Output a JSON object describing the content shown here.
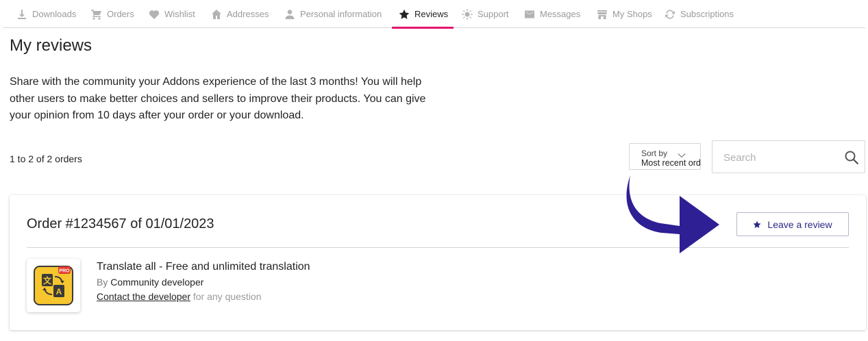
{
  "nav": {
    "items": [
      {
        "label": "Downloads",
        "icon": "download-icon",
        "active": false
      },
      {
        "label": "Orders",
        "icon": "cart-icon",
        "active": false
      },
      {
        "label": "Wishlist",
        "icon": "heart-icon",
        "active": false
      },
      {
        "label": "Addresses",
        "icon": "home-icon",
        "active": false
      },
      {
        "label": "Personal information",
        "icon": "person-icon",
        "active": false
      },
      {
        "label": "Reviews",
        "icon": "star-icon",
        "active": true
      },
      {
        "label": "Support",
        "icon": "sun-icon",
        "active": false
      },
      {
        "label": "Messages",
        "icon": "envelope-icon",
        "active": false
      },
      {
        "label": "My Shops",
        "icon": "shop-icon",
        "active": false
      },
      {
        "label": "Subscriptions",
        "icon": "refresh-icon",
        "active": false
      }
    ]
  },
  "page": {
    "title": "My reviews",
    "intro": "Share with the community your Addons experience of the last 3 months! You will help other users to make better choices and sellers to improve their products. You can give your opinion from 10 days after your order or your download.",
    "count": "1 to 2 of 2 orders"
  },
  "sort": {
    "label": "Sort by",
    "value": "Most recent orders"
  },
  "search": {
    "placeholder": "Search"
  },
  "order": {
    "title": "Order #1234567 of 01/01/2023",
    "review_button": "Leave a review",
    "product": {
      "name": "Translate all - Free and unlimited translation",
      "by_prefix": "By",
      "author": "Community developer",
      "contact_link": "Contact the developer",
      "contact_suffix": "for any question",
      "badge": "PRO"
    }
  },
  "colors": {
    "accent": "#e5156f",
    "brand": "#2b2a86",
    "arrow": "#2e1f95",
    "icon_yellow": "#f7c62f"
  }
}
